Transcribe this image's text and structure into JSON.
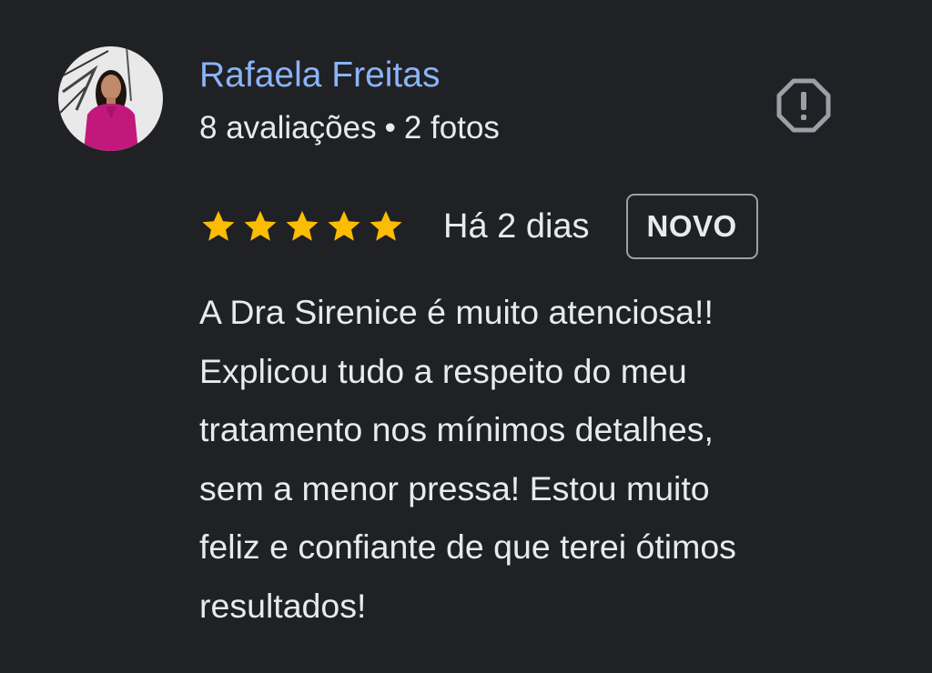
{
  "review": {
    "reviewer": {
      "name": "Rafaela Freitas",
      "reviews_count": "8 avaliações",
      "separator": "•",
      "photos_count": "2 fotos",
      "avatar_icon": "avatar-photo"
    },
    "flag": {
      "icon": "report-flag-icon"
    },
    "rating": {
      "stars": 5,
      "max_stars": 5,
      "star_color": "#fbbc04"
    },
    "date": "Há 2 dias",
    "badge": "NOVO",
    "text_lines": [
      "A Dra Sirenice é muito atenciosa!!",
      "Explicou tudo a respeito do meu",
      "tratamento nos mínimos detalhes,",
      "sem a menor pressa! Estou muito",
      "feliz e confiante de que terei ótimos",
      "resultados!"
    ]
  },
  "colors": {
    "background": "#202124",
    "name": "#8ab4f8",
    "text": "#e8eaed",
    "badge_border": "#9aa0a6"
  }
}
